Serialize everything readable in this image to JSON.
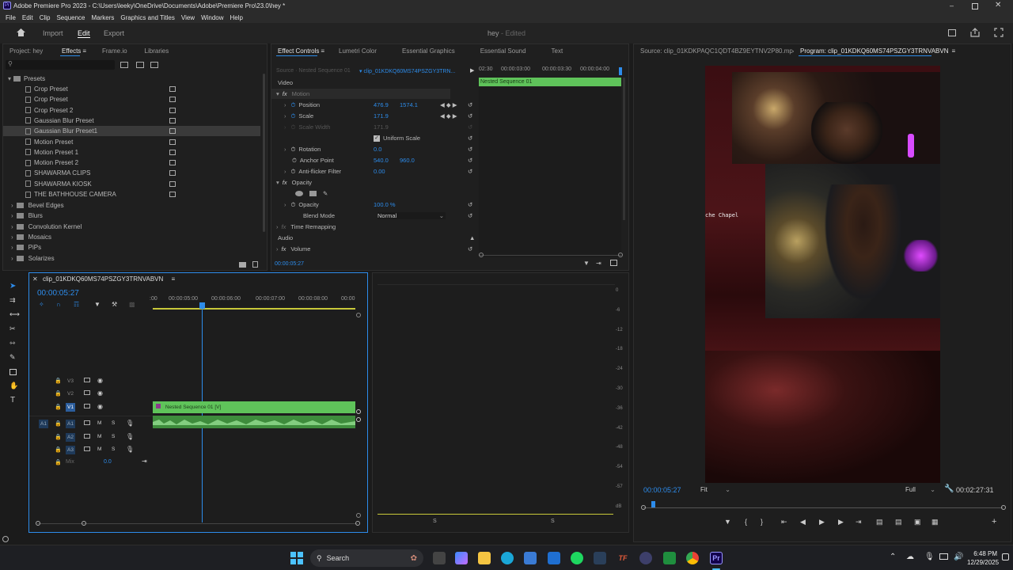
{
  "window": {
    "title": "Adobe Premiere Pro 2023 - C:\\Users\\leeky\\OneDrive\\Documents\\Adobe\\Premiere Pro\\23.0\\hey *"
  },
  "menu": [
    "File",
    "Edit",
    "Clip",
    "Sequence",
    "Markers",
    "Graphics and Titles",
    "View",
    "Window",
    "Help"
  ],
  "workspace": {
    "tabs": [
      "Import",
      "Edit",
      "Export"
    ],
    "active": "Edit",
    "project_name": "hey",
    "status": "Edited"
  },
  "effects_panel": {
    "tabs": [
      "Project: hey",
      "Effects",
      "Frame.io",
      "Libraries"
    ],
    "active_tab": "Effects",
    "root_folder": "Presets",
    "presets": [
      "Crop Preset",
      "Crop Preset",
      "Crop Preset 2",
      "Gaussian Blur Preset",
      "Gaussian Blur Preset1",
      "Motion Preset",
      "Motion Preset 1",
      "Motion Preset 2",
      "SHAWARMA CLIPS",
      "SHAWARMA KIOSK",
      "THE BATHHOUSE CAMERA"
    ],
    "selected_preset": "Gaussian Blur Preset1",
    "folders": [
      "Bevel Edges",
      "Blurs",
      "Convolution Kernel",
      "Mosaics",
      "PiPs",
      "Solarizes"
    ]
  },
  "effect_controls": {
    "tabs": [
      "Effect Controls",
      "Lumetri Color",
      "Essential Graphics",
      "Essential Sound",
      "Text"
    ],
    "source_label": "Source · Nested Sequence 01",
    "clip_label": "clip_01KDKQ60MS74PSZGY3TRN...",
    "timecodes": [
      "02:30",
      "00:00:03:00",
      "00:00:03:30",
      "00:00:04:00"
    ],
    "clip_bar_label": "Nested Sequence 01",
    "video_header": "Video",
    "motion": "Motion",
    "position_label": "Position",
    "position_x": "476.9",
    "position_y": "1574.1",
    "scale_label": "Scale",
    "scale": "171.9",
    "scale_width_label": "Scale Width",
    "scale_width": "171.9",
    "uniform_scale": "Uniform Scale",
    "rotation_label": "Rotation",
    "rotation": "0.0",
    "anchor_label": "Anchor Point",
    "anchor_x": "540.0",
    "anchor_y": "960.0",
    "antiflicker_label": "Anti-flicker Filter",
    "antiflicker": "0.00",
    "opacity_header": "Opacity",
    "opacity_label": "Opacity",
    "opacity": "100.0 %",
    "blend_label": "Blend Mode",
    "blend": "Normal",
    "time_remap": "Time Remapping",
    "audio_header": "Audio",
    "volume": "Volume",
    "timecode": "00:00:05:27"
  },
  "source_monitor": {
    "tab": "Source: clip_01KDKPAQC1QDT4BZ9EYTNV2P80.mp4"
  },
  "program_monitor": {
    "tab": "Program: clip_01KDKQ60MS74PSZGY3TRNVABVN",
    "overlay_text": "che Chapel",
    "timecode": "00:00:05:27",
    "fit": "Fit",
    "quality": "Full",
    "duration": "00:02:27:31"
  },
  "timeline": {
    "tab": "clip_01KDKQ60MS74PSZGY3TRNVABVN",
    "timecode": "00:00:05:27",
    "ruler": [
      "00:00:05:00",
      "00:00:06:00",
      "00:00:07:00",
      "00:00:08:00",
      "00:00"
    ],
    "ruler_start": ":00",
    "video_tracks": [
      "V3",
      "V2",
      "V1"
    ],
    "audio_tracks": [
      "A1",
      "A2",
      "A3"
    ],
    "source_patch": "A1",
    "mix_label": "Mix",
    "mix_value": "0.0",
    "clip_label": "Nested Sequence 01 [V]",
    "track_m": "M",
    "track_s": "S"
  },
  "audio_meter": {
    "ticks": [
      "0",
      "-6",
      "-12",
      "-18",
      "-24",
      "-30",
      "-36",
      "-42",
      "-48",
      "-54",
      "-57",
      "dB"
    ],
    "solo_left": "S",
    "solo_right": "S"
  },
  "taskbar": {
    "search": "Search",
    "time": "6:48 PM",
    "date": "12/29/2025"
  },
  "colors": {
    "accent": "#2d8ceb",
    "clip_green": "#5fc35a",
    "audio_green": "#4aa048",
    "timeline_yellow": "#c8c83a"
  }
}
